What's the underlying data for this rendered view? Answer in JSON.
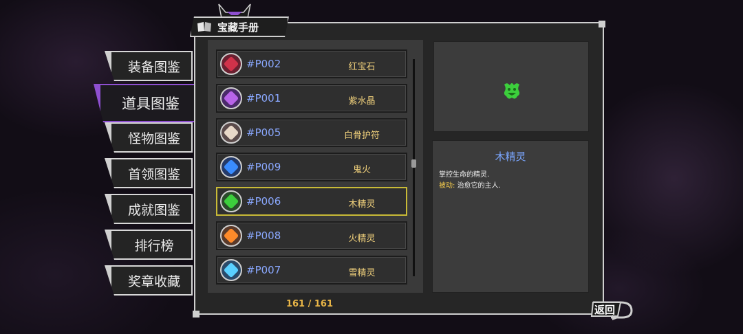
{
  "window": {
    "title": "宝藏手册"
  },
  "tabs": [
    {
      "label": "装备图鉴",
      "active": false
    },
    {
      "label": "道具图鉴",
      "active": true
    },
    {
      "label": "怪物图鉴",
      "active": false
    },
    {
      "label": "首领图鉴",
      "active": false
    },
    {
      "label": "成就图鉴",
      "active": false
    },
    {
      "label": "排行榜",
      "active": false
    },
    {
      "label": "奖章收藏",
      "active": false
    }
  ],
  "items": [
    {
      "code": "#P002",
      "name": "红宝石",
      "icon": "ruby-icon",
      "color": "#d1324a",
      "bg": "#6a2030"
    },
    {
      "code": "#P001",
      "name": "紫水晶",
      "icon": "amethyst-icon",
      "color": "#b864e8",
      "bg": "#4a2a6a"
    },
    {
      "code": "#P005",
      "name": "白骨护符",
      "icon": "bone-charm-icon",
      "color": "#e8d8c8",
      "bg": "#5a4a4a"
    },
    {
      "code": "#P009",
      "name": "鬼火",
      "icon": "ghost-fire-icon",
      "color": "#3a8cff",
      "bg": "#243a6a"
    },
    {
      "code": "#P006",
      "name": "木精灵",
      "icon": "wood-spirit-icon",
      "color": "#3ccf3c",
      "bg": "#2a4a2a",
      "selected": true
    },
    {
      "code": "#P008",
      "name": "火精灵",
      "icon": "fire-spirit-icon",
      "color": "#ff8a2a",
      "bg": "#5a3a2a"
    },
    {
      "code": "#P007",
      "name": "雪精灵",
      "icon": "snow-spirit-icon",
      "color": "#5ad0ff",
      "bg": "#2a4a6a"
    }
  ],
  "counter": "161 / 161",
  "detail": {
    "title": "木精灵",
    "line1": "掌控生命的精灵.",
    "passive_label": "被动:",
    "passive_text": "治愈它的主人."
  },
  "back_label": "返回",
  "colors": {
    "accent": "#8e4fd0",
    "gold": "#e8b547",
    "code_blue": "#8aa8ff",
    "selected_border": "#c9bb37"
  }
}
